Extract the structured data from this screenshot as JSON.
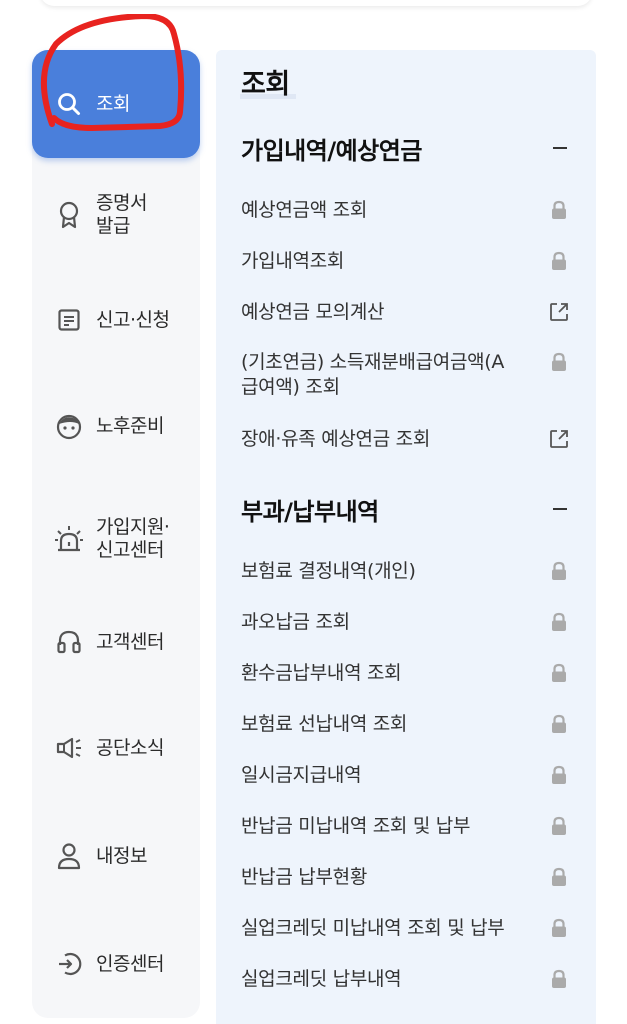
{
  "sidebar": {
    "items": [
      {
        "label": "조회",
        "icon": "search-icon",
        "active": true
      },
      {
        "label": "증명서\n발급",
        "icon": "award-icon"
      },
      {
        "label": "신고·신청",
        "icon": "document-icon"
      },
      {
        "label": "노후준비",
        "icon": "face-icon"
      },
      {
        "label": "가입지원·\n신고센터",
        "icon": "alarm-icon"
      },
      {
        "label": "고객센터",
        "icon": "headset-icon"
      },
      {
        "label": "공단소식",
        "icon": "megaphone-icon"
      },
      {
        "label": "내정보",
        "icon": "person-icon"
      },
      {
        "label": "인증센터",
        "icon": "login-icon"
      }
    ]
  },
  "panel": {
    "title": "조회",
    "sections": [
      {
        "title": "가입내역/예상연금",
        "items": [
          {
            "label": "예상연금액 조회",
            "icon": "lock-icon"
          },
          {
            "label": "가입내역조회",
            "icon": "lock-icon"
          },
          {
            "label": "예상연금 모의계산",
            "icon": "external-link-icon"
          },
          {
            "label": "(기초연금) 소득재분배급여금액(A\n급여액) 조회",
            "icon": "lock-icon"
          },
          {
            "label": "장애·유족 예상연금 조회",
            "icon": "external-link-icon"
          }
        ]
      },
      {
        "title": "부과/납부내역",
        "items": [
          {
            "label": "보험료 결정내역(개인)",
            "icon": "lock-icon"
          },
          {
            "label": "과오납금 조회",
            "icon": "lock-icon"
          },
          {
            "label": "환수금납부내역 조회",
            "icon": "lock-icon"
          },
          {
            "label": "보험료 선납내역 조회",
            "icon": "lock-icon"
          },
          {
            "label": "일시금지급내역",
            "icon": "lock-icon"
          },
          {
            "label": "반납금 미납내역 조회 및 납부",
            "icon": "lock-icon"
          },
          {
            "label": "반납금 납부현황",
            "icon": "lock-icon"
          },
          {
            "label": "실업크레딧 미납내역 조회 및 납부",
            "icon": "lock-icon"
          },
          {
            "label": "실업크레딧 납부내역",
            "icon": "lock-icon"
          }
        ]
      }
    ]
  },
  "colors": {
    "accent": "#4a7fdb",
    "panel_bg": "#eef4fc",
    "sidebar_bg": "#f6f7f9",
    "annotation": "#e8231f",
    "icon_gray": "#aaaaaa"
  }
}
